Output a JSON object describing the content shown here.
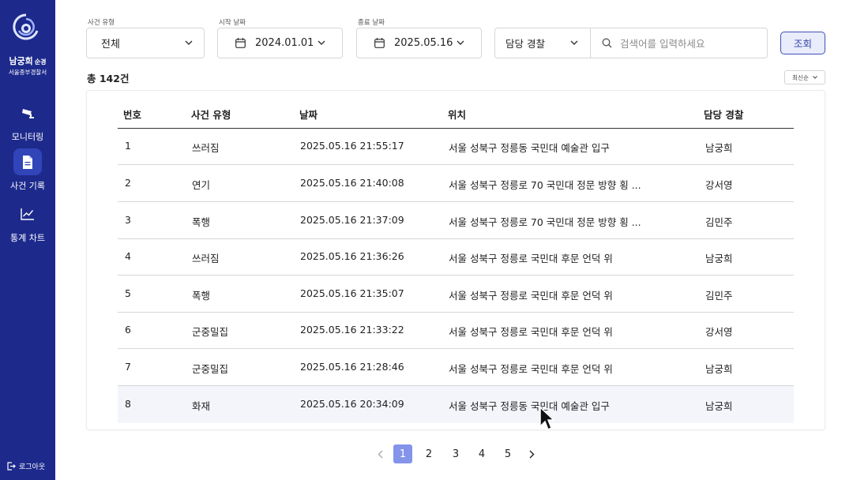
{
  "sidebar": {
    "user_name": "남궁희",
    "user_rank": "순경",
    "user_station": "서울종부경찰서",
    "nav": [
      {
        "label": "모니터링",
        "icon": "cctv-camera-icon",
        "active": false
      },
      {
        "label": "사건 기록",
        "icon": "document-icon",
        "active": true
      },
      {
        "label": "통계 차트",
        "icon": "line-chart-icon",
        "active": false
      }
    ],
    "logout_label": "로그아웃"
  },
  "filters": {
    "incident_type_label": "사건 유형",
    "incident_type_value": "전체",
    "start_date_label": "시작 날짜",
    "start_date_value": "2024.01.01",
    "end_date_label": "종료 날짜",
    "end_date_value": "2025.05.16",
    "officer_value": "담당 경찰",
    "search_placeholder": "검색어를 입력하세요",
    "search_button": "조회"
  },
  "summary": {
    "total": "총 142건",
    "sort": "최신순"
  },
  "table": {
    "headers": [
      "번호",
      "사건 유형",
      "날짜",
      "위치",
      "담당 경찰"
    ],
    "rows": [
      {
        "no": "1",
        "type": "쓰러짐",
        "date": "2025.05.16 21:55:17",
        "location": "서울 성북구 정릉동 국민대 예술관 입구",
        "officer": "남궁희"
      },
      {
        "no": "2",
        "type": "연기",
        "date": "2025.05.16 21:40:08",
        "location": "서울 성북구 정릉로 70 국민대 정문 방향 횡 ...",
        "officer": "강서영"
      },
      {
        "no": "3",
        "type": "폭행",
        "date": "2025.05.16 21:37:09",
        "location": "서울 성북구 정릉로 70 국민대 정문 방향 횡 ...",
        "officer": "김민주"
      },
      {
        "no": "4",
        "type": "쓰러짐",
        "date": "2025.05.16 21:36:26",
        "location": "서울 성북구 정릉로 국민대 후문 언덕 위",
        "officer": "남궁희"
      },
      {
        "no": "5",
        "type": "폭행",
        "date": "2025.05.16 21:35:07",
        "location": "서울 성북구 정릉로 국민대 후문 언덕 위",
        "officer": "김민주"
      },
      {
        "no": "6",
        "type": "군중밀집",
        "date": "2025.05.16 21:33:22",
        "location": "서울 성북구 정릉로 국민대 후문 언덕 위",
        "officer": "강서영"
      },
      {
        "no": "7",
        "type": "군중밀집",
        "date": "2025.05.16 21:28:46",
        "location": "서울 성북구 정릉로 국민대 후문 언덕 위",
        "officer": "남궁희"
      },
      {
        "no": "8",
        "type": "화재",
        "date": "2025.05.16 20:34:09",
        "location": "서울 성북구 정릉동 국민대 예술관 입구",
        "officer": "남궁희"
      }
    ]
  },
  "pagination": {
    "pages": [
      "1",
      "2",
      "3",
      "4",
      "5"
    ],
    "current": "1",
    "prev_icon": "chevron-left-icon",
    "next_icon": "chevron-right-icon"
  },
  "colors": {
    "sidebar_bg": "#1d2a8c",
    "accent": "#4050b5",
    "page_active": "#8494ea"
  }
}
